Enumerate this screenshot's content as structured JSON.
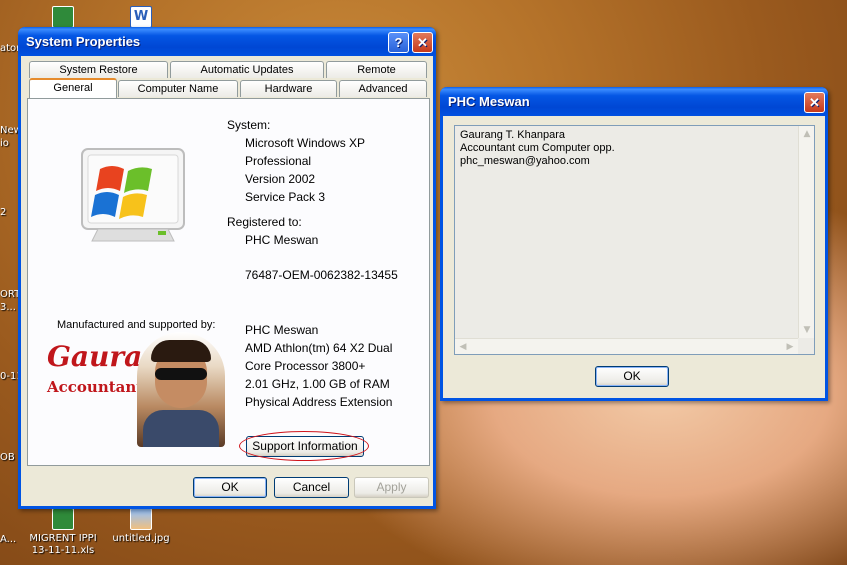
{
  "desktop": {
    "icons": [
      {
        "label": ""
      },
      {
        "label": ""
      },
      {
        "label": "MIGRENT IPPI 13-11-11.xls"
      },
      {
        "label": "untitled.jpg"
      }
    ],
    "edge_labels": [
      "ator",
      "New",
      "io",
      "2",
      "ORT",
      "3...",
      "0-11",
      "OB",
      "A..."
    ]
  },
  "system_properties": {
    "title": "System Properties",
    "help_glyph": "?",
    "close_glyph": "✕",
    "tabs_top": [
      "System Restore",
      "Automatic Updates",
      "Remote"
    ],
    "tabs_bottom": [
      "General",
      "Computer Name",
      "Hardware",
      "Advanced"
    ],
    "system_label": "System:",
    "system_lines": [
      "Microsoft Windows XP",
      "Professional",
      "Version 2002",
      "Service Pack 3"
    ],
    "registered_label": "Registered to:",
    "registered_name": "PHC Meswan",
    "product_id": "76487-OEM-0062382-13455",
    "manufactured_label": "Manufactured and supported by:",
    "logo_name": "Gaurang",
    "logo_sub": "Accountant",
    "support_lines": [
      "PHC Meswan",
      "AMD Athlon(tm) 64 X2 Dual",
      "Core Processor 3800+",
      "2.01 GHz, 1.00 GB of RAM",
      "Physical Address Extension"
    ],
    "support_button": "Support Information",
    "ok": "OK",
    "cancel": "Cancel",
    "apply": "Apply"
  },
  "phc_dialog": {
    "title": "PHC Meswan",
    "close_glyph": "✕",
    "lines": [
      "Gaurang T. Khanpara",
      "Accountant cum Computer opp.",
      "phc_meswan@yahoo.com"
    ],
    "ok": "OK"
  },
  "colors": {
    "titlebar": "#0054e3",
    "dialog_bg": "#ece9d8",
    "logo_red": "#c0161b"
  }
}
